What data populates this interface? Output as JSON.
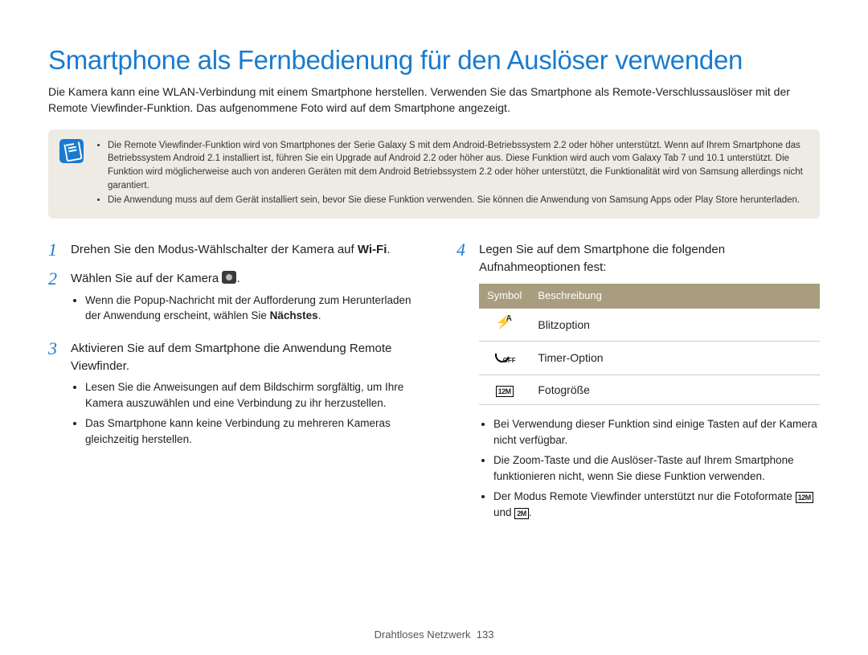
{
  "title": "Smartphone als Fernbedienung für den Auslöser verwenden",
  "intro": "Die Kamera kann eine WLAN-Verbindung mit einem Smartphone herstellen. Verwenden Sie das Smartphone als Remote-Verschlussauslöser mit der Remote Viewfinder-Funktion. Das aufgenommene Foto wird auf dem Smartphone angezeigt.",
  "note": {
    "items": [
      "Die Remote Viewfinder-Funktion wird von Smartphones der Serie Galaxy S mit dem Android-Betriebssystem 2.2 oder höher unterstützt. Wenn auf Ihrem Smartphone das Betriebssystem Android 2.1 installiert ist, führen Sie ein Upgrade auf Android 2.2 oder höher aus. Diese Funktion wird auch vom Galaxy Tab 7 und 10.1 unterstützt. Die Funktion wird möglicherweise auch von anderen Geräten mit dem Android Betriebssystem 2.2 oder höher unterstützt, die Funktionalität wird von Samsung allerdings nicht garantiert.",
      "Die Anwendung muss auf dem Gerät installiert sein, bevor Sie diese Funktion verwenden. Sie können die Anwendung von Samsung Apps oder Play Store herunterladen."
    ]
  },
  "steps": {
    "s1a": "Drehen Sie den Modus-Wählschalter der Kamera auf ",
    "s1b": "Wi-Fi",
    "s1c": ".",
    "s2a": "Wählen Sie auf der Kamera ",
    "s2b": ".",
    "s2_bullet_a": "Wenn die Popup-Nachricht mit der Aufforderung zum Herunterladen der Anwendung erscheint, wählen Sie ",
    "s2_bullet_b": "Nächstes",
    "s2_bullet_c": ".",
    "s3": "Aktivieren Sie auf dem Smartphone die Anwendung Remote Viewfinder.",
    "s3_bullets": [
      "Lesen Sie die Anweisungen auf dem Bildschirm sorgfältig, um Ihre Kamera auszuwählen und eine Verbindung zu ihr herzustellen.",
      "Das Smartphone kann keine Verbindung zu mehreren Kameras gleichzeitig herstellen."
    ],
    "s4": "Legen Sie auf dem Smartphone die folgenden Aufnahmeoptionen fest:",
    "s4_bullets": [
      "Bei Verwendung dieser Funktion sind einige Tasten auf der Kamera nicht verfügbar.",
      "Die Zoom-Taste und die Auslöser-Taste auf Ihrem Smartphone funktionieren nicht, wenn Sie diese Funktion verwenden."
    ],
    "s4_bullet3_a": "Der Modus Remote Viewfinder unterstützt nur die Fotoformate ",
    "s4_bullet3_mid": " und ",
    "s4_bullet3_end": ".",
    "size1": "12M",
    "size2": "2M"
  },
  "table": {
    "head_symbol": "Symbol",
    "head_desc": "Beschreibung",
    "rows": [
      {
        "desc": "Blitzoption"
      },
      {
        "desc": "Timer-Option"
      },
      {
        "desc": "Fotogröße"
      }
    ],
    "size_label": "12M"
  },
  "footer_section": "Drahtloses Netzwerk",
  "footer_page": "133"
}
